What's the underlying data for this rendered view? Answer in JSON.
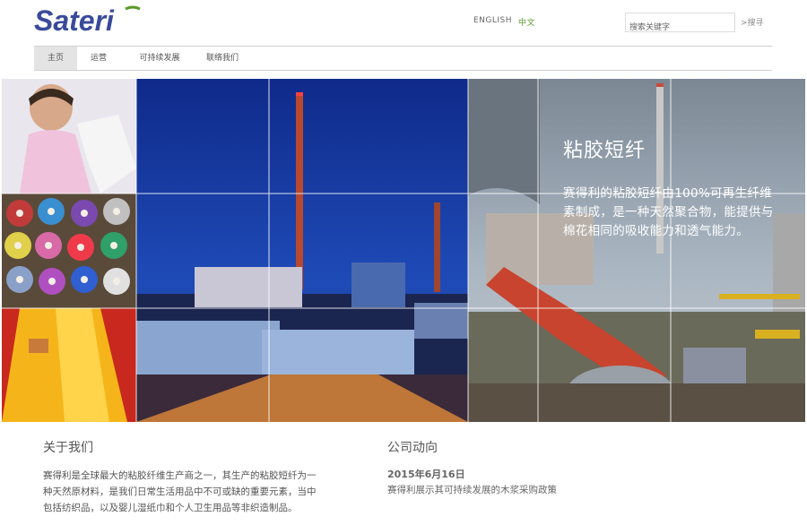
{
  "brand": {
    "name": "Sateri"
  },
  "header": {
    "lang_en": "ENGLISH",
    "lang_zh": "中文",
    "search_placeholder": "搜索关键字",
    "search_button": ">搜寻"
  },
  "nav": {
    "items": [
      {
        "label": "主页"
      },
      {
        "label": "运营"
      },
      {
        "label": "可持续发展"
      },
      {
        "label": "联络我们"
      }
    ]
  },
  "hero": {
    "title": "粘胶短纤",
    "description": "赛得利的粘胶短纤由100%可再生纤维素制成，是一种天然聚合物，能提供与棉花相同的吸收能力和透气能力。"
  },
  "about": {
    "heading": "关于我们",
    "text": "赛得利是全球最大的粘胶纤维生产商之一，其生产的粘胶短纤为一种天然原材料，是我们日常生活用品中不可或缺的重要元素，当中包括纺织品，以及婴儿湿纸巾和个人卫生用品等非织造制品。"
  },
  "news": {
    "heading": "公司动向",
    "date": "2015年6月16日",
    "link": "赛得利展示其可持续发展的木浆采购政策"
  },
  "colors": {
    "brand_blue": "#3a4a9a",
    "accent_green": "#5a9a2a"
  }
}
